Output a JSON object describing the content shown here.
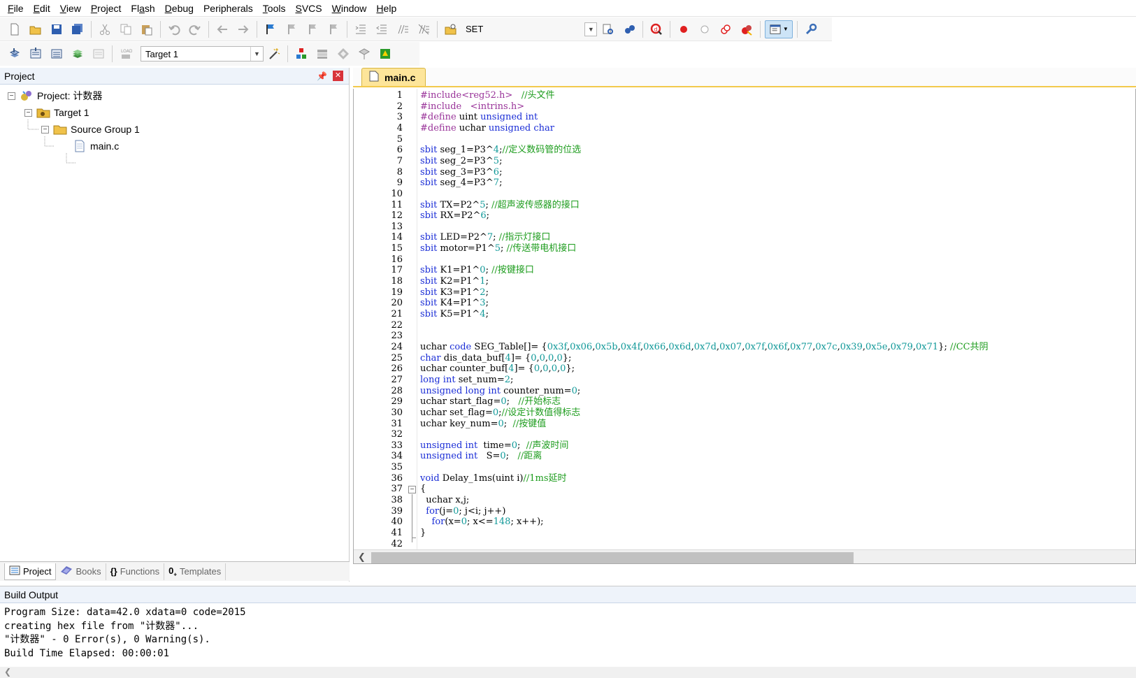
{
  "menu": [
    "File",
    "Edit",
    "View",
    "Project",
    "Flash",
    "Debug",
    "Peripherals",
    "Tools",
    "SVCS",
    "Window",
    "Help"
  ],
  "menu_underline": [
    "F",
    "E",
    "V",
    "P",
    "a",
    "D",
    "",
    "T",
    "S",
    "W",
    "H"
  ],
  "toolbar1": {
    "set_label": "SET"
  },
  "toolbar2": {
    "target_value": "Target 1"
  },
  "project_panel": {
    "title": "Project",
    "tree": [
      {
        "label": "Project: 计数器",
        "icon": "project-icon"
      },
      {
        "label": "Target 1",
        "icon": "target-folder-icon"
      },
      {
        "label": "Source Group 1",
        "icon": "folder-icon"
      },
      {
        "label": "main.c",
        "icon": "file-icon"
      }
    ],
    "tabs": [
      "Project",
      "Books",
      "Functions",
      "Templates"
    ]
  },
  "editor": {
    "tab_label": "main.c",
    "lines": [
      [
        [
          "pp",
          "#include<reg52.h>"
        ],
        [
          "",
          "   "
        ],
        [
          "cm",
          "//头文件"
        ]
      ],
      [
        [
          "pp",
          "#include   <intrins.h>"
        ]
      ],
      [
        [
          "pp",
          "#define"
        ],
        [
          "",
          " uint "
        ],
        [
          "kw",
          "unsigned int"
        ]
      ],
      [
        [
          "pp",
          "#define"
        ],
        [
          "",
          " uchar "
        ],
        [
          "kw",
          "unsigned char"
        ]
      ],
      [],
      [
        [
          "kw",
          "sbit"
        ],
        [
          "",
          " seg_1=P3^"
        ],
        [
          "num",
          "4"
        ],
        [
          "",
          ";"
        ],
        [
          "cm",
          "//定义数码管的位选"
        ]
      ],
      [
        [
          "kw",
          "sbit"
        ],
        [
          "",
          " seg_2=P3^"
        ],
        [
          "num",
          "5"
        ],
        [
          "",
          ";"
        ]
      ],
      [
        [
          "kw",
          "sbit"
        ],
        [
          "",
          " seg_3=P3^"
        ],
        [
          "num",
          "6"
        ],
        [
          "",
          ";"
        ]
      ],
      [
        [
          "kw",
          "sbit"
        ],
        [
          "",
          " seg_4=P3^"
        ],
        [
          "num",
          "7"
        ],
        [
          "",
          ";"
        ]
      ],
      [],
      [
        [
          "kw",
          "sbit"
        ],
        [
          "",
          " TX=P2^"
        ],
        [
          "num",
          "5"
        ],
        [
          "",
          "; "
        ],
        [
          "cm",
          "//超声波传感器的接口"
        ]
      ],
      [
        [
          "kw",
          "sbit"
        ],
        [
          "",
          " RX=P2^"
        ],
        [
          "num",
          "6"
        ],
        [
          "",
          ";"
        ]
      ],
      [],
      [
        [
          "kw",
          "sbit"
        ],
        [
          "",
          " LED=P2^"
        ],
        [
          "num",
          "7"
        ],
        [
          "",
          "; "
        ],
        [
          "cm",
          "//指示灯接口"
        ]
      ],
      [
        [
          "kw",
          "sbit"
        ],
        [
          "",
          " motor=P1^"
        ],
        [
          "num",
          "5"
        ],
        [
          "",
          "; "
        ],
        [
          "cm",
          "//传送带电机接口"
        ]
      ],
      [],
      [
        [
          "kw",
          "sbit"
        ],
        [
          "",
          " K1=P1^"
        ],
        [
          "num",
          "0"
        ],
        [
          "",
          "; "
        ],
        [
          "cm",
          "//按键接口"
        ]
      ],
      [
        [
          "kw",
          "sbit"
        ],
        [
          "",
          " K2=P1^"
        ],
        [
          "num",
          "1"
        ],
        [
          "",
          ";"
        ]
      ],
      [
        [
          "kw",
          "sbit"
        ],
        [
          "",
          " K3=P1^"
        ],
        [
          "num",
          "2"
        ],
        [
          "",
          ";"
        ]
      ],
      [
        [
          "kw",
          "sbit"
        ],
        [
          "",
          " K4=P1^"
        ],
        [
          "num",
          "3"
        ],
        [
          "",
          ";"
        ]
      ],
      [
        [
          "kw",
          "sbit"
        ],
        [
          "",
          " K5=P1^"
        ],
        [
          "num",
          "4"
        ],
        [
          "",
          ";"
        ]
      ],
      [],
      [],
      [
        [
          "",
          "uchar "
        ],
        [
          "kw",
          "code"
        ],
        [
          "",
          " SEG_Table[]= {"
        ],
        [
          "num",
          "0x3f"
        ],
        [
          "",
          ","
        ],
        [
          "num",
          "0x06"
        ],
        [
          "",
          ","
        ],
        [
          "num",
          "0x5b"
        ],
        [
          "",
          ","
        ],
        [
          "num",
          "0x4f"
        ],
        [
          "",
          ","
        ],
        [
          "num",
          "0x66"
        ],
        [
          "",
          ","
        ],
        [
          "num",
          "0x6d"
        ],
        [
          "",
          ","
        ],
        [
          "num",
          "0x7d"
        ],
        [
          "",
          ","
        ],
        [
          "num",
          "0x07"
        ],
        [
          "",
          ","
        ],
        [
          "num",
          "0x7f"
        ],
        [
          "",
          ","
        ],
        [
          "num",
          "0x6f"
        ],
        [
          "",
          ","
        ],
        [
          "num",
          "0x77"
        ],
        [
          "",
          ","
        ],
        [
          "num",
          "0x7c"
        ],
        [
          "",
          ","
        ],
        [
          "num",
          "0x39"
        ],
        [
          "",
          ","
        ],
        [
          "num",
          "0x5e"
        ],
        [
          "",
          ","
        ],
        [
          "num",
          "0x79"
        ],
        [
          "",
          ","
        ],
        [
          "num",
          "0x71"
        ],
        [
          "",
          "}; "
        ],
        [
          "cm",
          "//CC共阴"
        ]
      ],
      [
        [
          "kw",
          "char"
        ],
        [
          "",
          " dis_data_buf["
        ],
        [
          "num",
          "4"
        ],
        [
          "",
          "]= {"
        ],
        [
          "num",
          "0"
        ],
        [
          "",
          ","
        ],
        [
          "num",
          "0"
        ],
        [
          "",
          ","
        ],
        [
          "num",
          "0"
        ],
        [
          "",
          ","
        ],
        [
          "num",
          "0"
        ],
        [
          "",
          "};"
        ]
      ],
      [
        [
          "",
          "uchar counter_buf["
        ],
        [
          "num",
          "4"
        ],
        [
          "",
          "]= {"
        ],
        [
          "num",
          "0"
        ],
        [
          "",
          ","
        ],
        [
          "num",
          "0"
        ],
        [
          "",
          ","
        ],
        [
          "num",
          "0"
        ],
        [
          "",
          ","
        ],
        [
          "num",
          "0"
        ],
        [
          "",
          "};"
        ]
      ],
      [
        [
          "kw",
          "long int"
        ],
        [
          "",
          " set_num="
        ],
        [
          "num",
          "2"
        ],
        [
          "",
          ";"
        ]
      ],
      [
        [
          "kw",
          "unsigned long int"
        ],
        [
          "",
          " counter_num="
        ],
        [
          "num",
          "0"
        ],
        [
          "",
          ";"
        ]
      ],
      [
        [
          "",
          "uchar start_flag="
        ],
        [
          "num",
          "0"
        ],
        [
          "",
          ";   "
        ],
        [
          "cm",
          "//开始标志"
        ]
      ],
      [
        [
          "",
          "uchar set_flag="
        ],
        [
          "num",
          "0"
        ],
        [
          "",
          ";"
        ],
        [
          "cm",
          "//设定计数值得标志"
        ]
      ],
      [
        [
          "",
          "uchar key_num="
        ],
        [
          "num",
          "0"
        ],
        [
          "",
          ";  "
        ],
        [
          "cm",
          "//按键值"
        ]
      ],
      [],
      [
        [
          "kw",
          "unsigned int"
        ],
        [
          "",
          "  time="
        ],
        [
          "num",
          "0"
        ],
        [
          "",
          ";  "
        ],
        [
          "cm",
          "//声波时间"
        ]
      ],
      [
        [
          "kw",
          "unsigned int"
        ],
        [
          "",
          "   S="
        ],
        [
          "num",
          "0"
        ],
        [
          "",
          ";   "
        ],
        [
          "cm",
          "//距离"
        ]
      ],
      [],
      [
        [
          "kw",
          "void"
        ],
        [
          "",
          " Delay_1ms(uint i)"
        ],
        [
          "cm",
          "//1ms延时"
        ]
      ],
      [
        [
          "",
          "{"
        ]
      ],
      [
        [
          "",
          "  uchar x,j;"
        ]
      ],
      [
        [
          "",
          "  "
        ],
        [
          "kw",
          "for"
        ],
        [
          "",
          "(j="
        ],
        [
          "num",
          "0"
        ],
        [
          "",
          "; j<i; j++)"
        ]
      ],
      [
        [
          "",
          "    "
        ],
        [
          "kw",
          "for"
        ],
        [
          "",
          "(x="
        ],
        [
          "num",
          "0"
        ],
        [
          "",
          "; x<="
        ],
        [
          "num",
          "148"
        ],
        [
          "",
          "; x++);"
        ]
      ],
      [
        [
          "",
          "}"
        ]
      ],
      []
    ]
  },
  "build_output": {
    "title": "Build Output",
    "lines": [
      "Program Size: data=42.0 xdata=0 code=2015",
      "creating hex file from \"计数器\"...",
      "\"计数器\" - 0 Error(s), 0 Warning(s).",
      "Build Time Elapsed:  00:00:01"
    ]
  }
}
